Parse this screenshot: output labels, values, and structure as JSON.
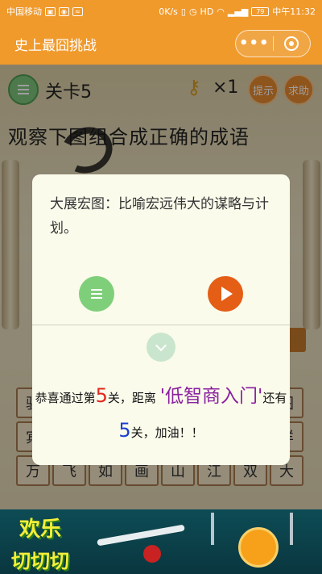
{
  "statusbar": {
    "carrier": "中国移动",
    "network_speed": "0K/s",
    "battery": "79",
    "time": "中午11:32"
  },
  "app": {
    "title": "史上最囧挑战",
    "capsule_more": "•••"
  },
  "game": {
    "level_label": "关卡5",
    "key_count": "×1",
    "hint_label": "提示",
    "help_label": "求助",
    "question": "观察下图组合成正确的成语",
    "tile_rows": [
      [
        "驯",
        "",
        "",
        "",
        "",
        "",
        "",
        "图"
      ],
      [
        "宾",
        "",
        "",
        "",
        "",
        "",
        "",
        "样"
      ],
      [
        "万",
        "飞",
        "如",
        "画",
        "山",
        "江",
        "双",
        "大"
      ]
    ]
  },
  "modal": {
    "meaning": "大展宏图：比喻宏远伟大的谋略与计划。",
    "congrats_prefix": "恭喜通过第",
    "level_number": "5",
    "congrats_mid": "关，距离",
    "goal": "'低智商入门'",
    "remaining_prefix": "还有",
    "remaining_number": "5",
    "congrats_suffix": "关，加油！！"
  },
  "ad": {
    "line1": "欢乐",
    "line2": "切切切"
  },
  "colors": {
    "brand_orange": "#f09a2c",
    "play_orange": "#e45e16",
    "green": "#7fcf7a",
    "level_red": "#e0281f",
    "remaining_blue": "#1c3fd1",
    "goal_purple": "#8a1fa0"
  }
}
